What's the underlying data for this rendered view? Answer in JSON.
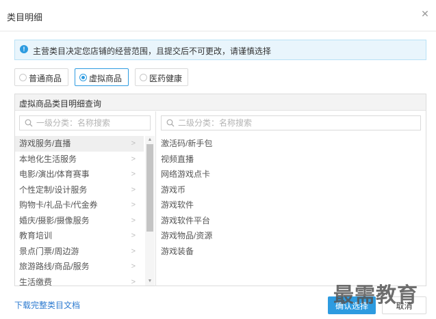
{
  "dialog": {
    "title": "类目明细",
    "close_icon": "close-icon"
  },
  "notice": {
    "icon": "info-icon",
    "text": "主营类目决定您店铺的经营范围，且提交后不可更改，请谨慎选择"
  },
  "types": [
    {
      "label": "普通商品",
      "selected": false
    },
    {
      "label": "虚拟商品",
      "selected": true
    },
    {
      "label": "医药健康",
      "selected": false
    }
  ],
  "panel": {
    "title": "虚拟商品类目明细查询",
    "left_search": {
      "placeholder": "一级分类：名称搜索",
      "value": ""
    },
    "right_search": {
      "placeholder": "二级分类：名称搜索",
      "value": ""
    },
    "level1": [
      "游戏服务/直播",
      "本地化生活服务",
      "电影/演出/体育赛事",
      "个性定制/设计服务",
      "购物卡/礼品卡/代金券",
      "婚庆/摄影/摄像服务",
      "教育培训",
      "景点门票/周边游",
      "旅游路线/商品/服务",
      "生活缴费"
    ],
    "level1_selected_index": 0,
    "level2": [
      "激活码/新手包",
      "视频直播",
      "网络游戏点卡",
      "游戏币",
      "游戏软件",
      "游戏软件平台",
      "游戏物品/资源",
      "游戏装备"
    ]
  },
  "footer": {
    "download_link": "下载完整类目文档",
    "confirm_label": "确认选择",
    "cancel_label": "取消"
  },
  "watermark": "最需教育",
  "colors": {
    "accent": "#2d9be0",
    "notice_bg": "#e9f5fc",
    "link": "#2d7bd0"
  }
}
